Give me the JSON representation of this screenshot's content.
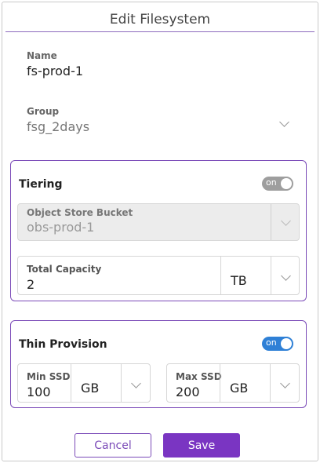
{
  "dialog": {
    "title": "Edit Filesystem"
  },
  "name": {
    "label": "Name",
    "value": "fs-prod-1"
  },
  "group": {
    "label": "Group",
    "value": "fsg_2days"
  },
  "tiering": {
    "title": "Tiering",
    "toggle_label": "on",
    "bucket": {
      "label": "Object Store Bucket",
      "value": "obs-prod-1"
    },
    "capacity": {
      "label": "Total Capacity",
      "value": "2",
      "unit": "TB"
    }
  },
  "thin_provision": {
    "title": "Thin Provision",
    "toggle_label": "on",
    "min_ssd": {
      "label": "Min SSD",
      "value": "100",
      "unit": "GB"
    },
    "max_ssd": {
      "label": "Max SSD",
      "value": "200",
      "unit": "GB"
    }
  },
  "actions": {
    "cancel_label": "Cancel",
    "save_label": "Save"
  },
  "colors": {
    "accent": "#7a35c2",
    "toggle_on": "#2f80d6",
    "toggle_off": "#9e9e9e"
  }
}
